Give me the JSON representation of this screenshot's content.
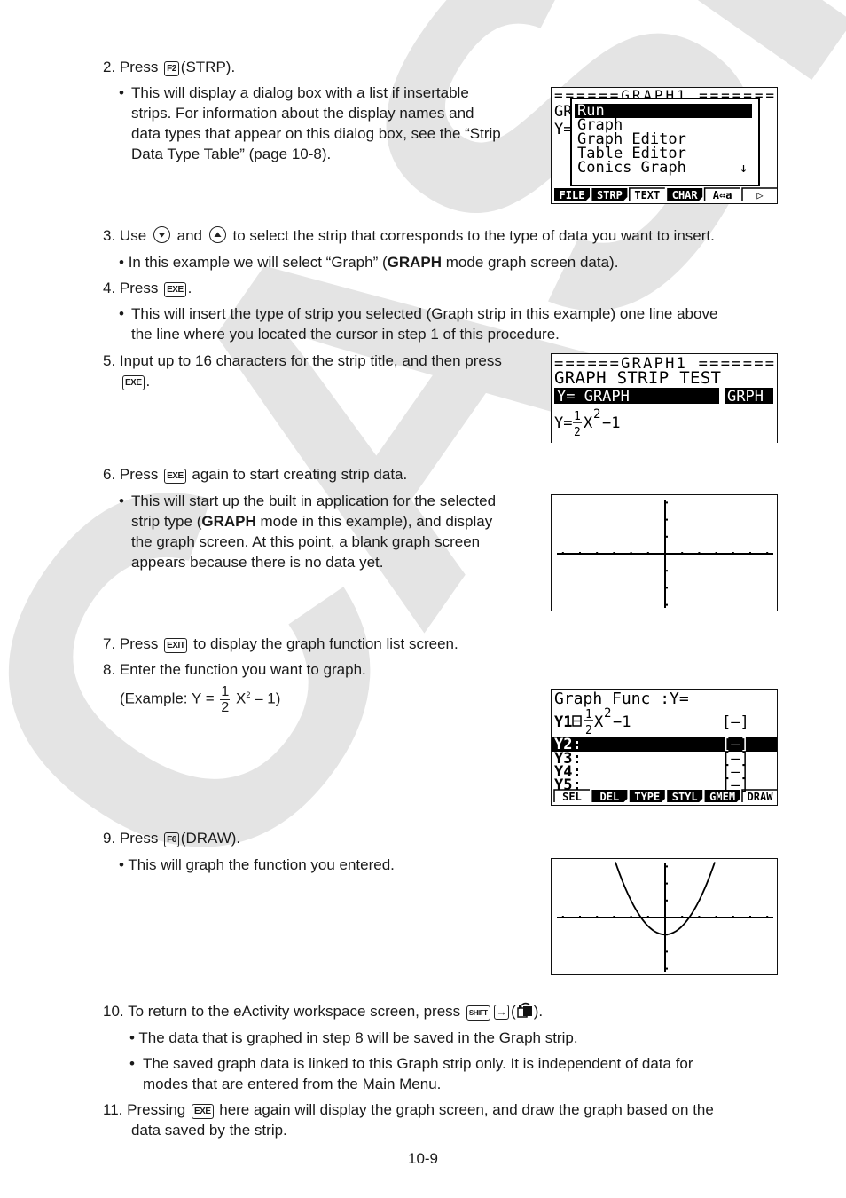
{
  "watermark": {
    "text": "CASIO",
    "color": "#e4e4e4"
  },
  "steps": {
    "s2": {
      "num": "2.",
      "pre": "Press",
      "key": "F2",
      "post": "(STRP).",
      "bullet": [
        "This will display a dialog box with a list if insertable",
        "strips. For information about the display names and",
        "data types that appear on this dialog box, see the “Strip",
        "Data Type Table” (page 10-8)."
      ]
    },
    "s3": {
      "num": "3.",
      "pre": "Use",
      "mid": "and",
      "post": "to select the strip that corresponds to the type of data you want to insert.",
      "bullet_pre": "In this example we will select “Graph” (",
      "bullet_bold": "GRAPH",
      "bullet_post": " mode graph screen data)."
    },
    "s4": {
      "num": "4.",
      "pre": "Press",
      "key": "EXE",
      "post": ".",
      "bullet": [
        "This will insert the type of strip you selected (Graph strip in this example) one line above",
        "the line where you located the cursor in step 1 of this procedure."
      ]
    },
    "s5": {
      "num": "5.",
      "line1": "Input up to 16 characters for the strip title, and then press",
      "key": "EXE",
      "post": "."
    },
    "s6": {
      "num": "6.",
      "pre": "Press",
      "key": "EXE",
      "post": "again to start creating strip data.",
      "bullet_l1": "This will start up the built in application for the selected",
      "bullet_l2_pre": "strip type (",
      "bullet_l2_bold": "GRAPH",
      "bullet_l2_post": " mode in this example), and display",
      "bullet_l3": "the graph screen. At this point, a blank graph screen",
      "bullet_l4": "appears because there is no data yet."
    },
    "s7": {
      "num": "7.",
      "pre": "Press",
      "key": "EXIT",
      "post": "to display the graph function list screen."
    },
    "s8": {
      "num": "8.",
      "line1": "Enter the function you want to graph.",
      "ex_pre": "(Example: Y =",
      "frac_num": "1",
      "frac_den": "2",
      "ex_var": "X",
      "ex_sup": "2",
      "ex_post": "– 1)"
    },
    "s9": {
      "num": "9.",
      "pre": "Press",
      "key": "F6",
      "post": "(DRAW).",
      "bullet": "This will graph the function you entered."
    },
    "s10": {
      "num": "10.",
      "pre": "To return to the eActivity workspace screen, press",
      "key1": "SHIFT",
      "key2": "→",
      "post_open": "(",
      "post_close": ").",
      "bullets": [
        [
          "The data that is graphed in step 8 will be saved in the Graph strip."
        ],
        [
          "The saved graph data is linked to this Graph strip only. It is independent of data for",
          "modes that are entered from the Main Menu."
        ]
      ]
    },
    "s11": {
      "num": "11.",
      "pre": "Pressing",
      "key": "EXE",
      "post": "here again will display the graph screen, and draw the graph based on the",
      "line2": "data saved by the strip."
    }
  },
  "screens": {
    "strip_dialog": {
      "header": "======GRAPH1  =======",
      "behind": [
        "GR",
        "Y="
      ],
      "items": [
        "Run",
        "Graph",
        "Graph Editor",
        "Table Editor",
        "Conics Graph"
      ],
      "selected_index": 0,
      "scroll_indicator": "↓",
      "fkeys": [
        {
          "label": "FILE",
          "inv": true
        },
        {
          "label": "STRP",
          "inv": true
        },
        {
          "label": "TEXT",
          "inv": false
        },
        {
          "label": "CHAR",
          "inv": true
        },
        {
          "label": "A⇔a",
          "inv": false
        },
        {
          "label": "▷",
          "inv": false
        }
      ]
    },
    "strip_title": {
      "header": "======GRAPH1  =======",
      "title": "GRAPH STRIP TEST",
      "strip_label": "Y= GRAPH",
      "strip_tag": "GRPH",
      "eq_pre": "Y=",
      "eq_num": "1",
      "eq_den": "2",
      "eq_var": "X",
      "eq_sup": "2",
      "eq_post": "−1"
    },
    "blank_graph": {
      "x_ticks": 12,
      "y_ticks_up": 3,
      "y_ticks_down": 3
    },
    "graph_func": {
      "header": "Graph Func  :Y=",
      "rows": [
        {
          "label": "Y1",
          "expr_num": "1",
          "expr_den": "2",
          "expr_var": "X",
          "expr_sup": "2",
          "expr_post": "−1",
          "style": "[—]",
          "selected": false
        },
        {
          "label": "Y2:",
          "style": "[—]",
          "selected": true
        },
        {
          "label": "Y3:",
          "style": "[—]",
          "selected": false
        },
        {
          "label": "Y4:",
          "style": "[—]",
          "selected": false
        },
        {
          "label": "Y5:",
          "style": "[—]",
          "selected": false
        }
      ],
      "fkeys": [
        {
          "label": "SEL",
          "inv": false
        },
        {
          "label": "DEL",
          "inv": true
        },
        {
          "label": "TYPE",
          "inv": true
        },
        {
          "label": "STYL",
          "inv": true
        },
        {
          "label": "GMEM",
          "inv": true
        },
        {
          "label": "DRAW",
          "inv": false
        }
      ]
    },
    "drawn_graph": {
      "function": "y = 0.5*x^2 - 1",
      "xmin": -6.3,
      "xmax": 6.3,
      "ymin": -3.1,
      "ymax": 3.1
    }
  },
  "footer": {
    "page_number": "10-9"
  }
}
